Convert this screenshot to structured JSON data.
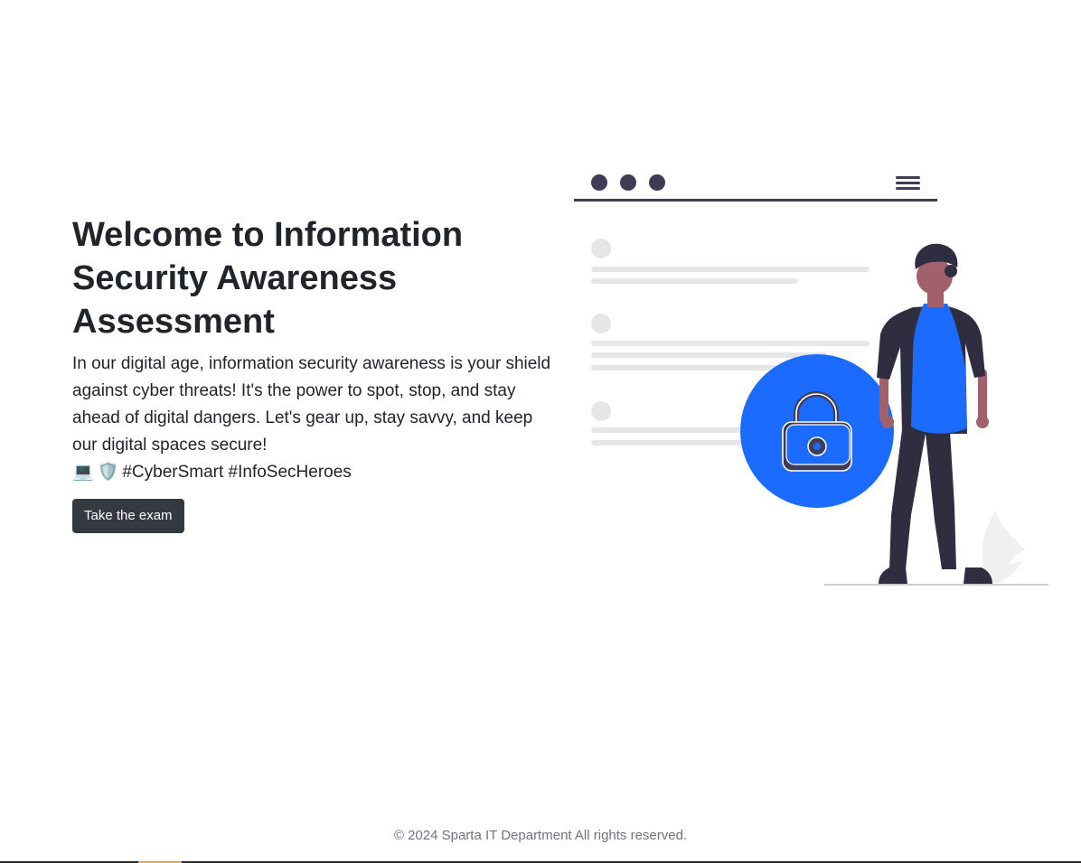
{
  "hero": {
    "title": "Welcome to Information Security Awareness Assessment",
    "description": "In our digital age, information security awareness is your shield against cyber threats! It's the power to spot, stop, and stay ahead of digital dangers. Let's gear up, stay savvy, and keep our digital spaces secure!",
    "emoji_laptop": "💻",
    "emoji_shield": "🛡️",
    "hashtags": "#CyberSmart #InfoSecHeroes",
    "button_label": "Take the exam"
  },
  "illustration": {
    "icons": [
      "browser-dots-icon",
      "hamburger-menu-icon",
      "lock-icon",
      "person-figure",
      "plant-icon"
    ],
    "colors": {
      "accent": "#1c6bff",
      "dark": "#3f3d56",
      "placeholder": "#e6e6e6",
      "skin": "#a0616a",
      "hair": "#2f2e41"
    }
  },
  "footer": {
    "text": "© 2024 Sparta IT Department All rights reserved."
  },
  "colors": {
    "button_bg": "#343a40",
    "text": "#212529",
    "footer_text": "#6c757d"
  }
}
